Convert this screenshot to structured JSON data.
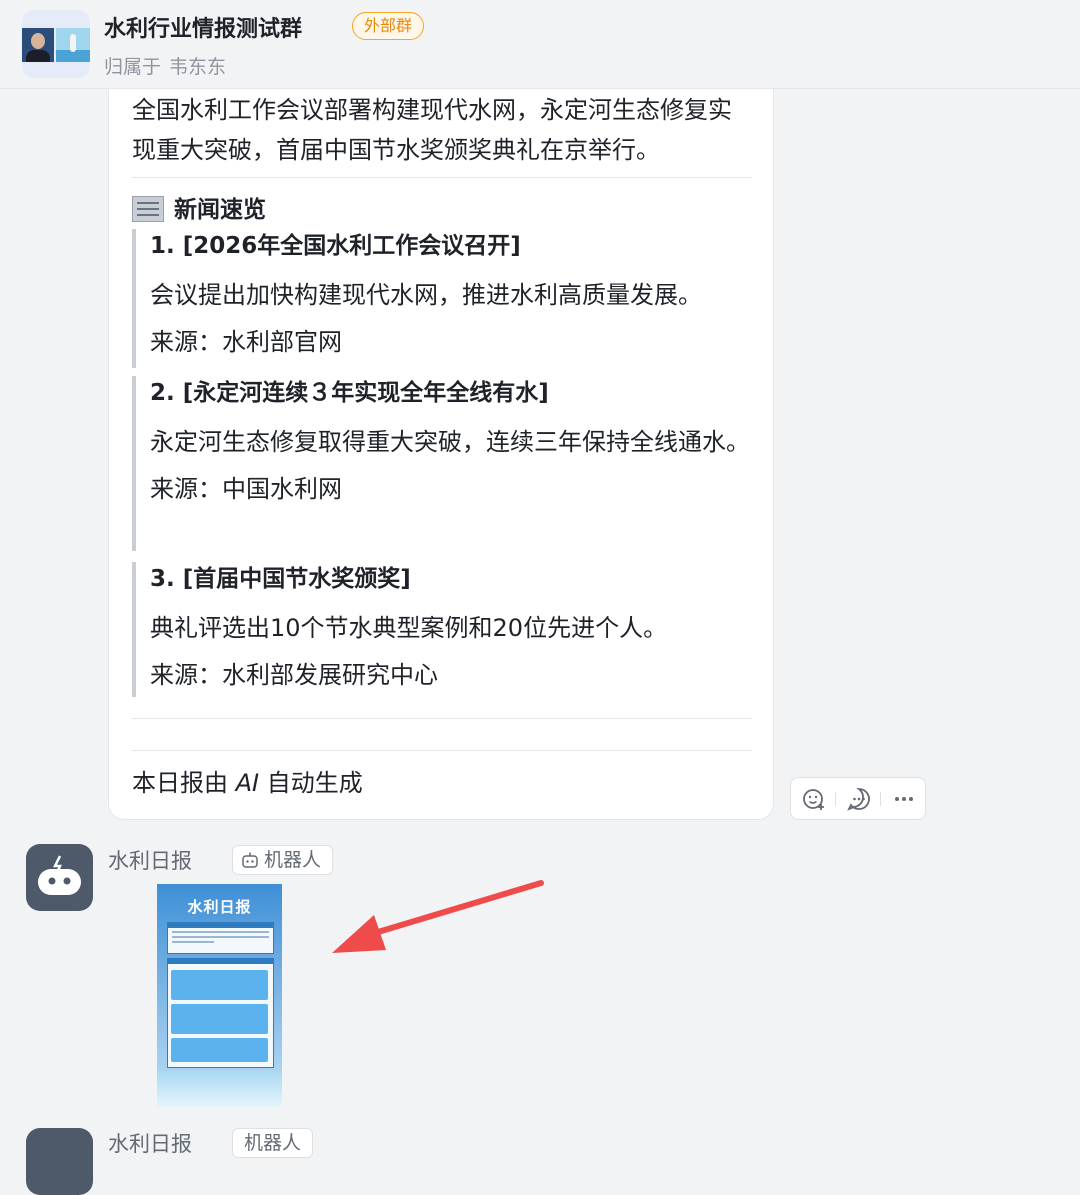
{
  "header": {
    "group_name": "水利行业情报测试群",
    "badge": "外部群",
    "owner_prefix": "归属于",
    "owner_name": "韦东东"
  },
  "message": {
    "intro": "全国水利工作会议部署构建现代水网，永定河生态修复实现重大突破，首届中国节水奖颁奖典礼在京举行。",
    "section_icon": "newspaper-icon",
    "section_title": "新闻速览",
    "news": [
      {
        "title": "1. [2026年全国水利工作会议召开]",
        "desc": "会议提出加快构建现代水网，推进水利高质量发展。",
        "source": "来源：水利部官网"
      },
      {
        "title": "2. [永定河连续３年实现全年全线有水]",
        "desc": "永定河生态修复取得重大突破，连续三年保持全线通水。",
        "source": "来源：中国水利网"
      },
      {
        "title": "3. [首届中国节水奖颁奖]",
        "desc": "典礼评选出10个节水典型案例和20位先进个人。",
        "source": "来源：水利部发展研究中心"
      }
    ],
    "footer_prefix": "本日报由",
    "footer_ai": "AI",
    "footer_suffix": "自动生成"
  },
  "toolbar": {
    "icons": [
      "add-reaction-icon",
      "reply-icon",
      "more-icon"
    ]
  },
  "bot": {
    "name": "水利日报",
    "tag": "机器人",
    "thumbnail_title": "水利日报"
  },
  "next_message": {
    "name": "水利日报",
    "tag": "机器人"
  },
  "colors": {
    "badge": "#f5a623",
    "arrow": "#ef4b4b",
    "bot_avatar": "#4e5969"
  }
}
